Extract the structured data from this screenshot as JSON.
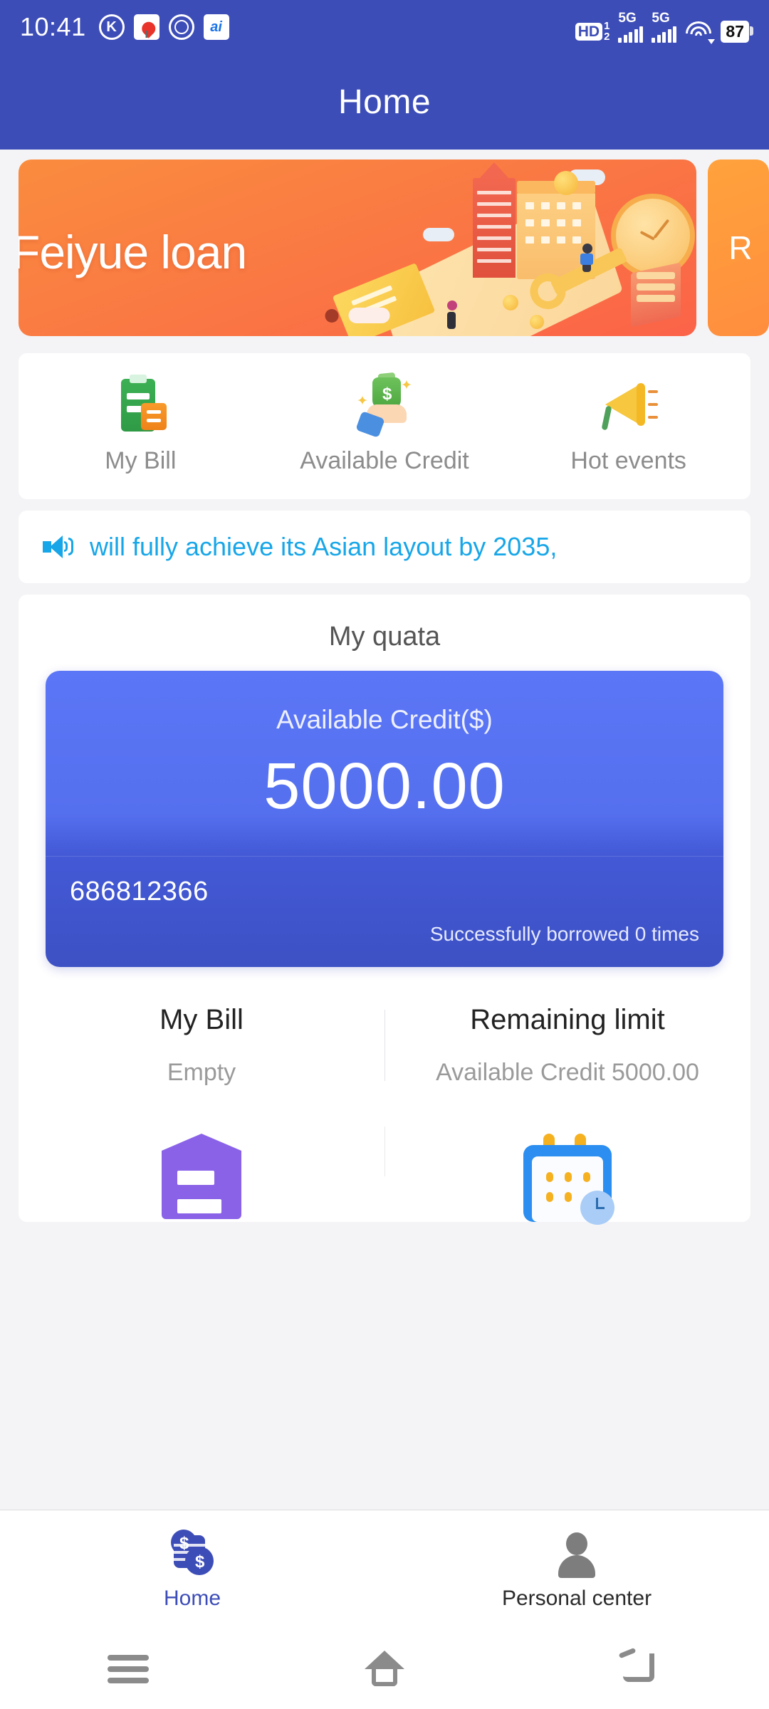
{
  "statusbar": {
    "time": "10:41",
    "left_icons": [
      "k-circle-icon",
      "map-pin-icon",
      "hand-circle-icon",
      "blue-app-icon"
    ],
    "hd_label": "HD",
    "hd_line1": "1",
    "hd_line2": "2",
    "network1": "5G",
    "network2": "5G",
    "wifi": "wifi-icon",
    "battery": "87"
  },
  "header": {
    "title": "Home"
  },
  "banner": {
    "title": "Feiyue loan",
    "peek_title": "R",
    "dots": [
      "inactive",
      "active"
    ]
  },
  "quick_actions": [
    {
      "label": "My Bill",
      "icon": "bill-icon"
    },
    {
      "label": "Available Credit",
      "icon": "money-hand-icon"
    },
    {
      "label": "Hot events",
      "icon": "megaphone-icon"
    }
  ],
  "notice": {
    "icon": "speaker-icon",
    "text": "will fully achieve its Asian layout by 2035,",
    "color": "#17a6e8"
  },
  "quota": {
    "section_title": "My quata",
    "card": {
      "label": "Available Credit($)",
      "amount": "5000.00",
      "account": "686812366",
      "borrow_times": "Successfully borrowed 0 times",
      "gradient_top": "#5b76f6",
      "gradient_bottom": "#3d51c4"
    },
    "stats": [
      {
        "title": "My Bill",
        "sub": "Empty"
      },
      {
        "title": "Remaining limit",
        "sub": "Available Credit 5000.00"
      }
    ],
    "services": [
      {
        "icon": "shield-document-icon"
      },
      {
        "icon": "calendar-clock-icon"
      }
    ]
  },
  "tabbar": [
    {
      "label": "Home",
      "icon": "coins-icon",
      "active": true
    },
    {
      "label": "Personal center",
      "icon": "user-icon",
      "active": false
    }
  ],
  "android_nav": [
    "menu-icon",
    "home-icon",
    "back-icon"
  ]
}
